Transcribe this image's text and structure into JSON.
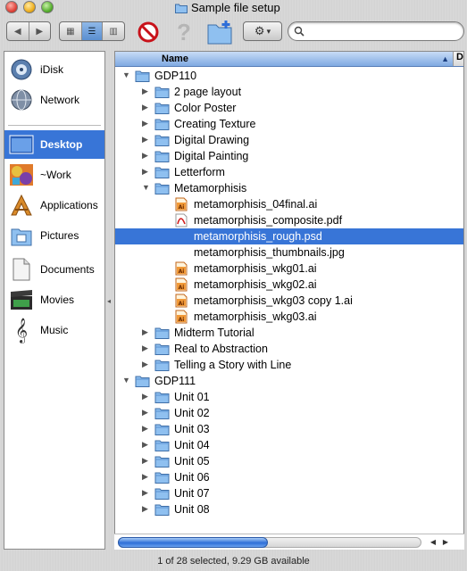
{
  "window": {
    "title": "Sample file setup"
  },
  "toolbar": {
    "back_label": "◀",
    "forward_label": "▶",
    "icon_view_label": "▦",
    "list_view_label": "☰",
    "column_view_label": "▥",
    "action_caret": "▾"
  },
  "search": {
    "placeholder": ""
  },
  "sidebar": {
    "items": [
      {
        "label": "iDisk",
        "icon": "idisk-icon"
      },
      {
        "label": "Network",
        "icon": "network-icon"
      },
      {
        "label": "Desktop",
        "icon": "desktop-icon"
      },
      {
        "label": "~Work",
        "icon": "work-icon"
      },
      {
        "label": "Applications",
        "icon": "applications-icon"
      },
      {
        "label": "Pictures",
        "icon": "pictures-icon"
      },
      {
        "label": "Documents",
        "icon": "documents-icon"
      },
      {
        "label": "Movies",
        "icon": "movies-icon"
      },
      {
        "label": "Music",
        "icon": "music-icon"
      }
    ]
  },
  "list": {
    "column_name": "Name",
    "second_column": "D",
    "rows": [
      {
        "label": "GDP110",
        "kind": "folder",
        "level": 0,
        "expanded": true
      },
      {
        "label": "2 page layout",
        "kind": "folder",
        "level": 1,
        "expanded": false
      },
      {
        "label": "Color Poster",
        "kind": "folder",
        "level": 1,
        "expanded": false
      },
      {
        "label": "Creating Texture",
        "kind": "folder",
        "level": 1,
        "expanded": false
      },
      {
        "label": "Digital Drawing",
        "kind": "folder",
        "level": 1,
        "expanded": false
      },
      {
        "label": "Digital Painting",
        "kind": "folder",
        "level": 1,
        "expanded": false
      },
      {
        "label": "Letterform",
        "kind": "folder",
        "level": 1,
        "expanded": false
      },
      {
        "label": "Metamorphisis",
        "kind": "folder",
        "level": 1,
        "expanded": true
      },
      {
        "label": "metamorphisis_04final.ai",
        "kind": "ai",
        "level": 2
      },
      {
        "label": "metamorphisis_composite.pdf",
        "kind": "pdf",
        "level": 2
      },
      {
        "label": "metamorphisis_rough.psd",
        "kind": "psd",
        "level": 2,
        "selected": true
      },
      {
        "label": "metamorphisis_thumbnails.jpg",
        "kind": "jpg",
        "level": 2
      },
      {
        "label": "metamorphisis_wkg01.ai",
        "kind": "ai",
        "level": 2
      },
      {
        "label": "metamorphisis_wkg02.ai",
        "kind": "ai",
        "level": 2
      },
      {
        "label": "metamorphisis_wkg03 copy 1.ai",
        "kind": "ai",
        "level": 2
      },
      {
        "label": "metamorphisis_wkg03.ai",
        "kind": "ai",
        "level": 2
      },
      {
        "label": "Midterm Tutorial",
        "kind": "folder",
        "level": 1,
        "expanded": false
      },
      {
        "label": "Real to Abstraction",
        "kind": "folder",
        "level": 1,
        "expanded": false
      },
      {
        "label": "Telling a Story with Line",
        "kind": "folder",
        "level": 1,
        "expanded": false
      },
      {
        "label": "GDP111",
        "kind": "folder",
        "level": 0,
        "expanded": true
      },
      {
        "label": "Unit 01",
        "kind": "folder",
        "level": 1,
        "expanded": false
      },
      {
        "label": "Unit 02",
        "kind": "folder",
        "level": 1,
        "expanded": false
      },
      {
        "label": "Unit 03",
        "kind": "folder",
        "level": 1,
        "expanded": false
      },
      {
        "label": "Unit 04",
        "kind": "folder",
        "level": 1,
        "expanded": false
      },
      {
        "label": "Unit 05",
        "kind": "folder",
        "level": 1,
        "expanded": false
      },
      {
        "label": "Unit 06",
        "kind": "folder",
        "level": 1,
        "expanded": false
      },
      {
        "label": "Unit 07",
        "kind": "folder",
        "level": 1,
        "expanded": false
      },
      {
        "label": "Unit 08",
        "kind": "folder",
        "level": 1,
        "expanded": false
      }
    ]
  },
  "status": {
    "text": "1 of 28 selected, 9.29 GB available"
  },
  "colors": {
    "selection": "#3875d7",
    "folder": "#8fc0f0"
  }
}
